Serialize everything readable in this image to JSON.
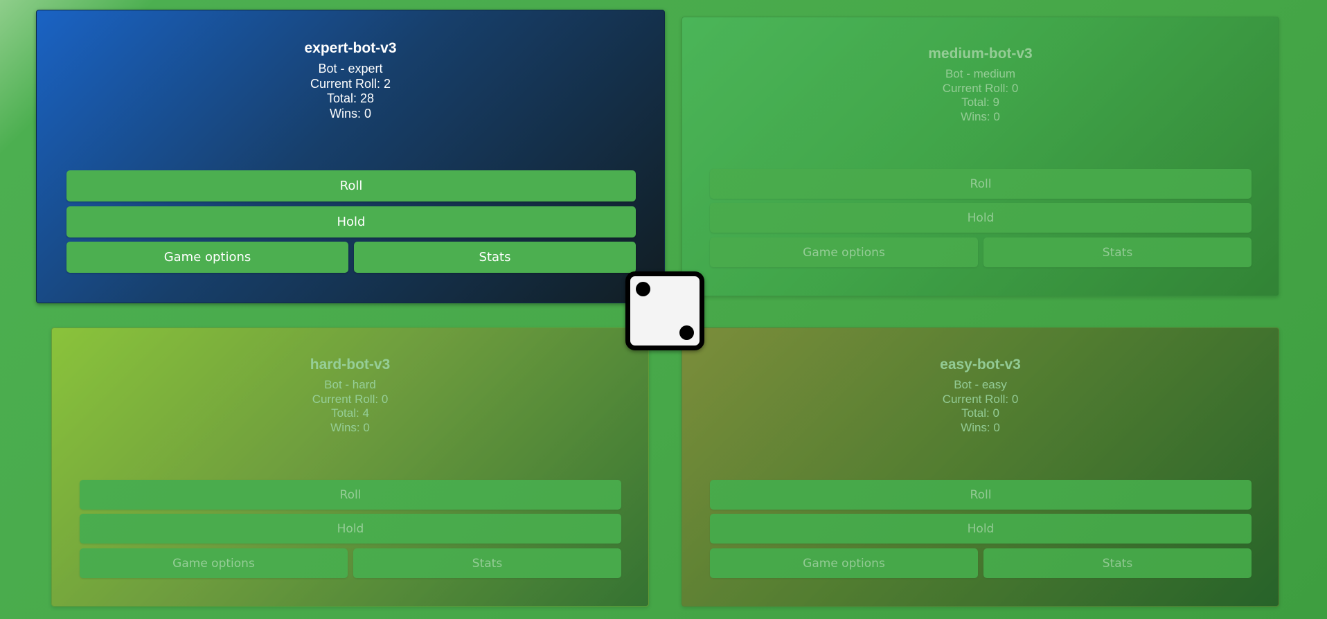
{
  "players": {
    "expert": {
      "name": "expert-bot-v3",
      "type": "Bot - expert",
      "current_roll": "Current Roll: 2",
      "total": "Total: 28",
      "wins": "Wins: 0",
      "roll_label": "Roll",
      "hold_label": "Hold",
      "options_label": "Game options",
      "stats_label": "Stats",
      "active": true
    },
    "medium": {
      "name": "medium-bot-v3",
      "type": "Bot - medium",
      "current_roll": "Current Roll: 0",
      "total": "Total: 9",
      "wins": "Wins: 0",
      "roll_label": "Roll",
      "hold_label": "Hold",
      "options_label": "Game options",
      "stats_label": "Stats",
      "active": false
    },
    "hard": {
      "name": "hard-bot-v3",
      "type": "Bot - hard",
      "current_roll": "Current Roll: 0",
      "total": "Total: 4",
      "wins": "Wins: 0",
      "roll_label": "Roll",
      "hold_label": "Hold",
      "options_label": "Game options",
      "stats_label": "Stats",
      "active": false
    },
    "easy": {
      "name": "easy-bot-v3",
      "type": "Bot - easy",
      "current_roll": "Current Roll: 0",
      "total": "Total: 0",
      "wins": "Wins: 0",
      "roll_label": "Roll",
      "hold_label": "Hold",
      "options_label": "Game options",
      "stats_label": "Stats",
      "active": false
    }
  },
  "dice": {
    "value": 2,
    "pips": [
      "top-left",
      "bottom-right"
    ]
  },
  "colors": {
    "button": "#4caf50",
    "background": "#4caf50",
    "expert_panel": "#1a63c4",
    "medium_panel": "#4ec46a",
    "hard_panel": "#e1e222",
    "easy_panel": "#c46a28"
  }
}
